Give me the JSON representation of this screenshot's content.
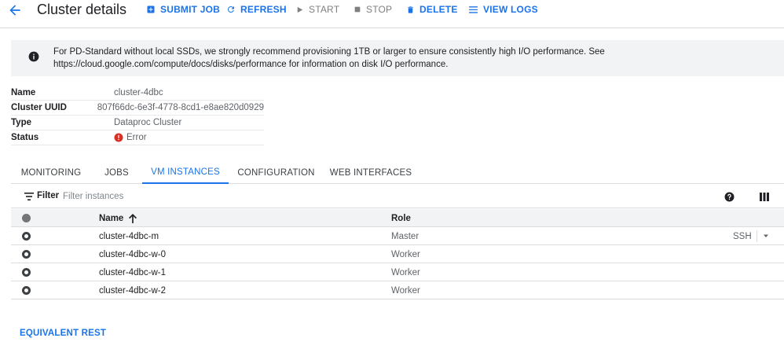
{
  "header": {
    "title": "Cluster details",
    "actions": {
      "submit_job": "SUBMIT JOB",
      "refresh": "REFRESH",
      "start": "START",
      "stop": "STOP",
      "delete": "DELETE",
      "view_logs": "VIEW LOGS"
    }
  },
  "banner": {
    "text": "For PD-Standard without local SSDs, we strongly recommend provisioning 1TB or larger to ensure consistently high I/O performance. See https://cloud.google.com/compute/docs/disks/performance for information on disk I/O performance."
  },
  "details": [
    {
      "label": "Name",
      "value": "cluster-4dbc"
    },
    {
      "label": "Cluster UUID",
      "value": "807f66dc-6e3f-4778-8cd1-e8ae820d0929"
    },
    {
      "label": "Type",
      "value": "Dataproc Cluster"
    },
    {
      "label": "Status",
      "value": "Error"
    }
  ],
  "tabs": [
    "MONITORING",
    "JOBS",
    "VM INSTANCES",
    "CONFIGURATION",
    "WEB INTERFACES"
  ],
  "active_tab": "VM INSTANCES",
  "filter": {
    "label": "Filter",
    "placeholder": "Filter instances"
  },
  "table": {
    "columns": {
      "name": "Name",
      "role": "Role"
    },
    "sort": {
      "column": "Name",
      "direction": "ascending"
    },
    "rows": [
      {
        "name": "cluster-4dbc-m",
        "role": "Master",
        "action": "SSH"
      },
      {
        "name": "cluster-4dbc-w-0",
        "role": "Worker"
      },
      {
        "name": "cluster-4dbc-w-1",
        "role": "Worker"
      },
      {
        "name": "cluster-4dbc-w-2",
        "role": "Worker"
      }
    ]
  },
  "footer": {
    "equivalent_rest": "EQUIVALENT REST"
  },
  "colors": {
    "accent": "#1a73e8",
    "error": "#d93025",
    "banner_bg": "#f1f3f4",
    "disabled": "#7f7f7f"
  },
  "icons": {
    "back": "arrow-left-icon",
    "submit_job": "plus-box-icon",
    "refresh": "refresh-icon",
    "start": "play-icon",
    "stop": "stop-icon",
    "delete": "trash-icon",
    "view_logs": "list-icon",
    "banner": "info-icon",
    "status": "error-icon",
    "filter": "filter-icon",
    "help": "help-icon",
    "columns": "columns-icon",
    "sort": "arrow-up-icon",
    "ssh_menu": "dropdown-arrow-icon"
  }
}
